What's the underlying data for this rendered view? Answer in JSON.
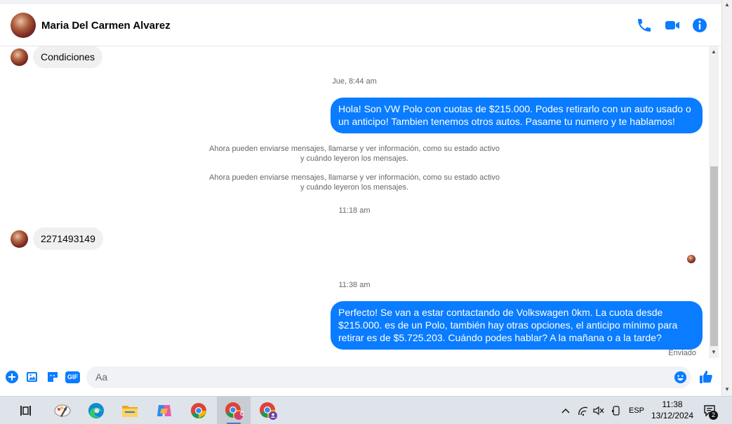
{
  "header": {
    "contact_name": "Maria Del Carmen Alvarez",
    "icons": [
      "phone-icon",
      "video-camera-icon",
      "info-icon"
    ],
    "accent_color": "#0a7cff"
  },
  "messages": {
    "incoming_1": "Condiciones",
    "timestamp_1": "Jue, 8:44 am",
    "outgoing_1": "Hola! Son VW Polo con cuotas de $215.000. Podes retirarlo con un auto usado o un anticipo! Tambien tenemos otros autos. Pasame tu numero y te hablamos!",
    "system_1_line1": "Ahora pueden enviarse mensajes, llamarse y ver información, como su estado activo",
    "system_1_line2": "y cuándo leyeron los mensajes.",
    "system_2_line1": "Ahora pueden enviarse mensajes, llamarse y ver información, como su estado activo",
    "system_2_line2": "y cuándo leyeron los mensajes.",
    "timestamp_2": "11:18 am",
    "incoming_2": "2271493149",
    "timestamp_3": "11:38 am",
    "outgoing_2": "Perfecto!  Se van a estar contactando de Volkswagen 0km. La cuota desde $215.000. es de un Polo, también hay otras opciones, el anticipo mínimo para retirar es de $5.725.203. Cuándo podes hablar? A la mañana o a la tarde?",
    "sent_status": "Enviado"
  },
  "composer": {
    "placeholder": "Aa",
    "icons": [
      "plus-icon",
      "image-icon",
      "sticker-icon",
      "gif-icon",
      "emoji-icon",
      "thumbs-up-icon"
    ],
    "gif_label": "GIF"
  },
  "taskbar": {
    "apps": [
      "task-view",
      "paint",
      "edge",
      "file-explorer",
      "copilot",
      "chrome",
      "chrome-profile-c",
      "chrome-profile-2"
    ],
    "language": "ESP",
    "time": "11:38",
    "date": "13/12/2024",
    "notification_count": "2",
    "badge_c": "C"
  }
}
